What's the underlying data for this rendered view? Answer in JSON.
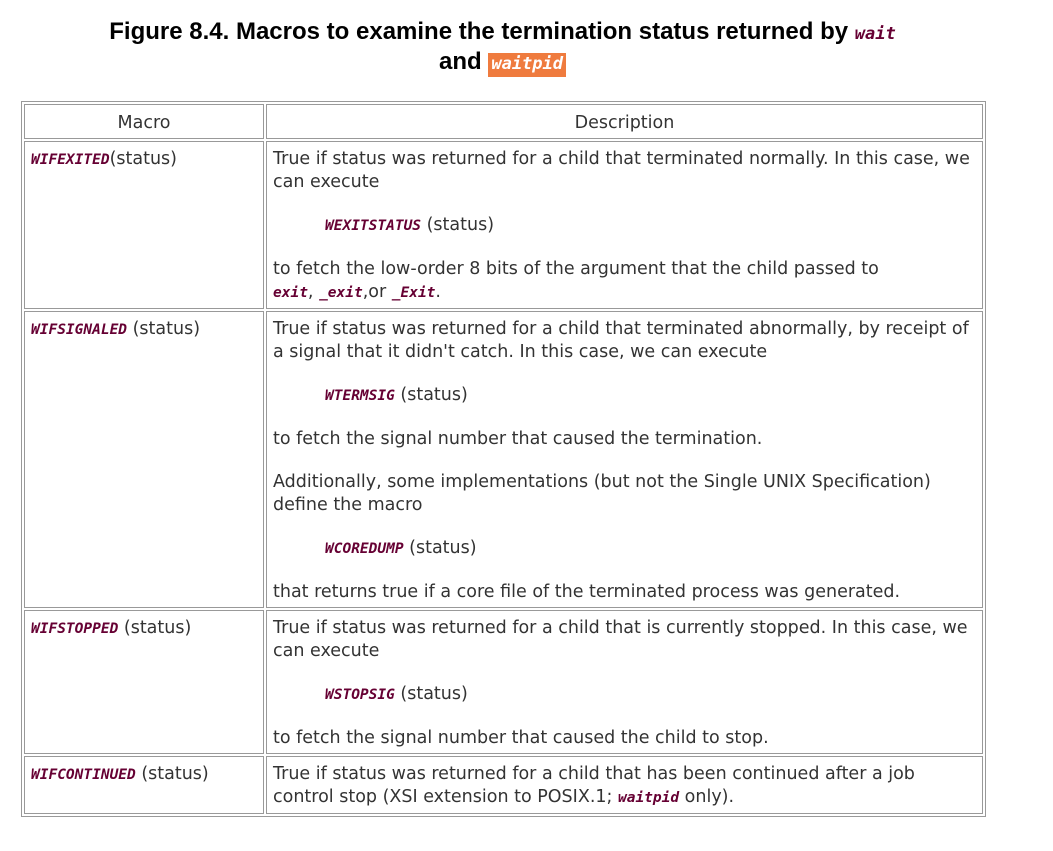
{
  "caption": {
    "prefix": "Figure 8.4. Macros to examine the termination status returned by",
    "code1": "wait",
    "and": "and",
    "code2": "waitpid"
  },
  "table": {
    "headers": {
      "macro": "Macro",
      "description": "Description"
    },
    "rows": [
      {
        "macro": "WIFEXITED",
        "macro_args": "(status)",
        "p1": "True if status was returned for a child that terminated normally. In this case, we can execute",
        "sub_macro": "WEXITSTATUS",
        "sub_args": " (status)",
        "p3_text": "to fetch the low-order 8 bits of the argument that the child passed to",
        "fn1": "exit",
        "sep1": ", ",
        "fn2": "_exit",
        "sep2": ",or ",
        "fn3": "_Exit",
        "end": "."
      },
      {
        "macro": "WIFSIGNALED",
        "macro_args": " (status)",
        "p1": "True if status was returned for a child that terminated abnormally, by receipt of a signal that it didn't catch. In this case, we can execute",
        "sub_macro": "WTERMSIG",
        "sub_args": " (status)",
        "p3": "to fetch the signal number that caused the termination.",
        "p4": "Additionally, some implementations (but not the Single UNIX Specification) define the macro",
        "sub_macro2": "WCOREDUMP",
        "sub_args2": " (status)",
        "p6": "that returns true if a core file of the terminated process was generated."
      },
      {
        "macro": "WIFSTOPPED",
        "macro_args": " (status)",
        "p1": "True if status was returned for a child that is currently stopped. In this case, we can execute",
        "sub_macro": "WSTOPSIG",
        "sub_args": " (status)",
        "p3": "to fetch the signal number that caused the child to stop."
      },
      {
        "macro": "WIFCONTINUED",
        "macro_args": " (status)",
        "p1_text": "True if status was returned for a child that has been continued after a job control stop (XSI extension to POSIX.1; ",
        "p1_code": "waitpid",
        "p1_end": " only)."
      }
    ]
  }
}
